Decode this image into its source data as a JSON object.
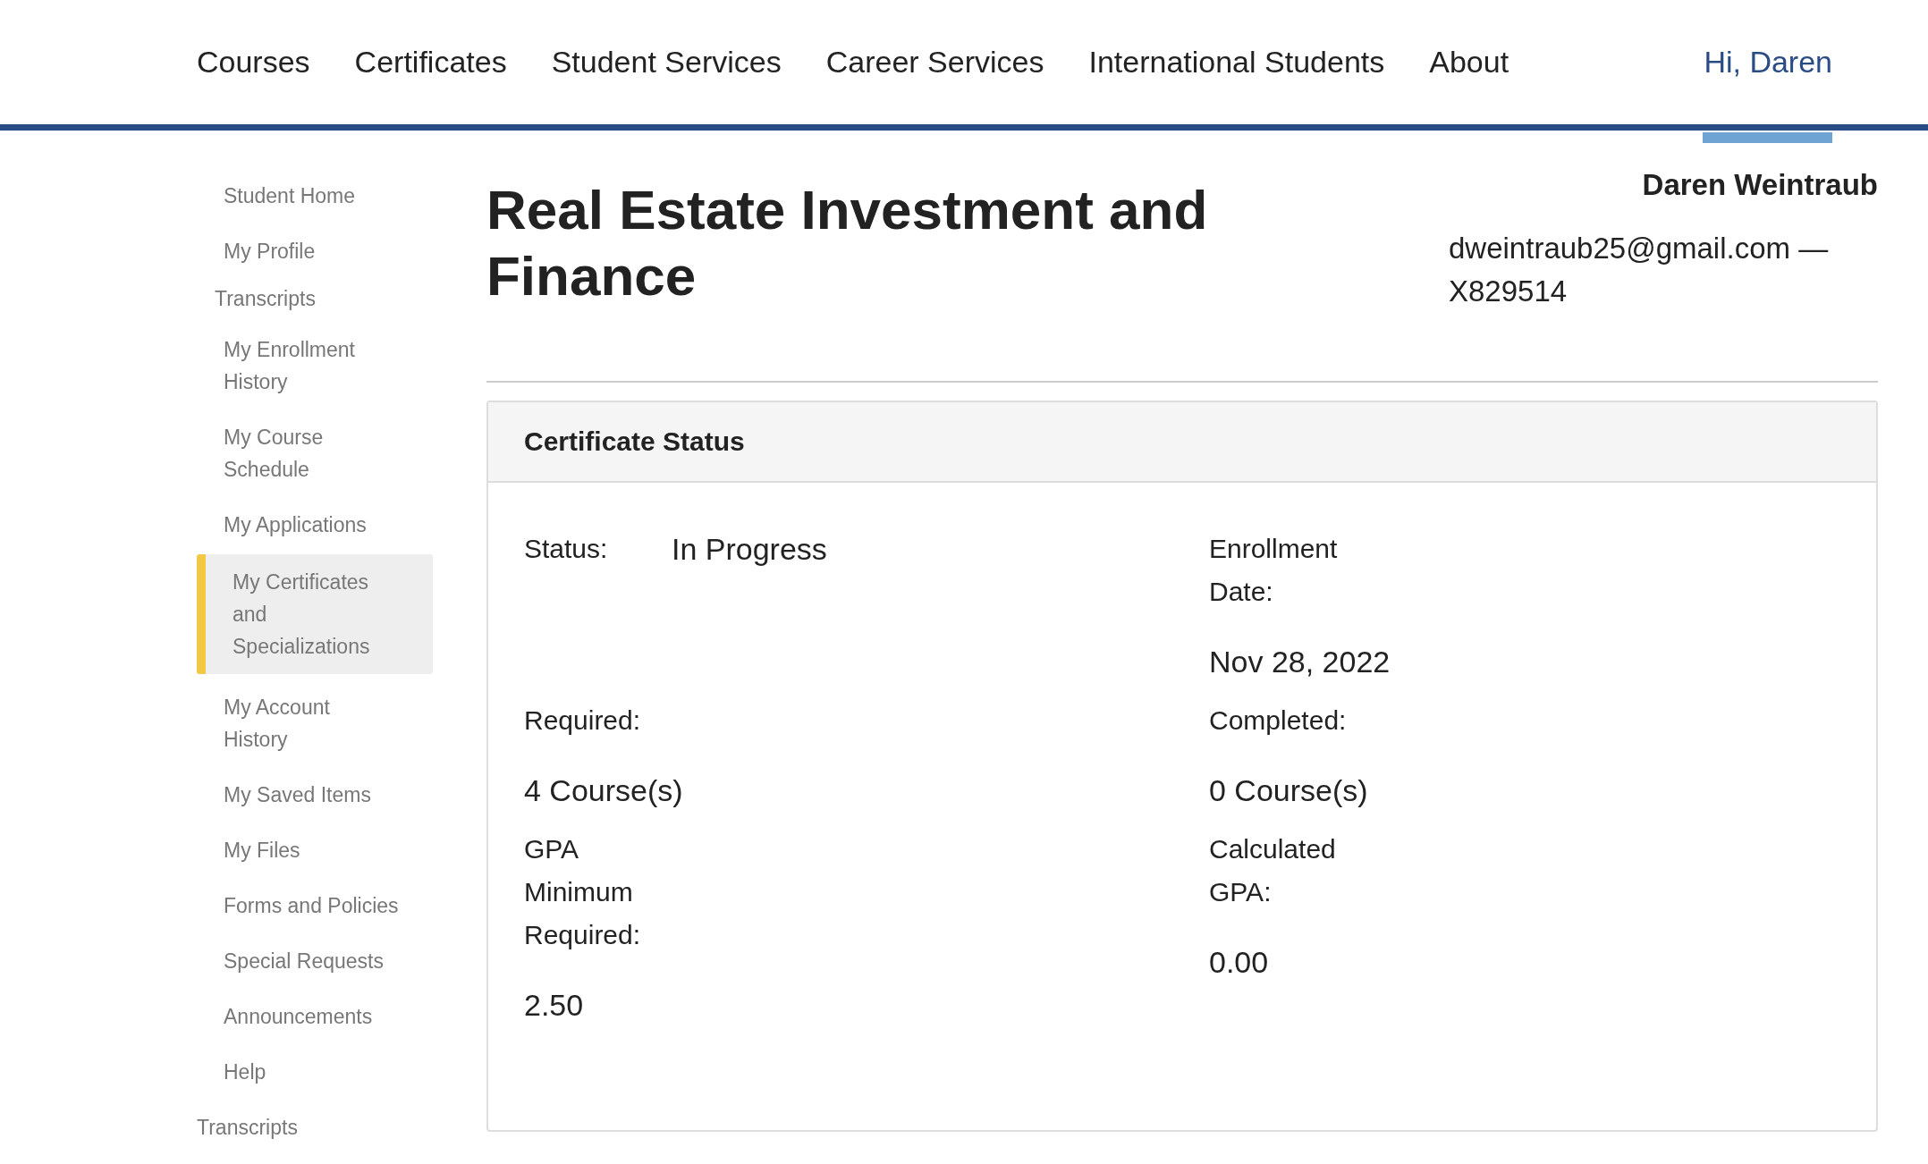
{
  "nav": {
    "items": [
      {
        "label": "Courses"
      },
      {
        "label": "Certificates"
      },
      {
        "label": "Student Services"
      },
      {
        "label": "Career Services"
      },
      {
        "label": "International Students"
      },
      {
        "label": "About"
      }
    ],
    "greeting": "Hi, Daren"
  },
  "sidebar": {
    "items": [
      {
        "label": "Student Home",
        "kind": "link",
        "selected": false
      },
      {
        "label": "My Profile",
        "kind": "link",
        "selected": false
      },
      {
        "label": "Transcripts",
        "kind": "heading",
        "selected": false
      },
      {
        "label": "My Enrollment History",
        "kind": "link",
        "selected": false
      },
      {
        "label": "My Course Schedule",
        "kind": "link",
        "selected": false
      },
      {
        "label": "My Applications",
        "kind": "link",
        "selected": false
      },
      {
        "label": "My Certificates and Specializations",
        "kind": "link",
        "selected": true
      },
      {
        "label": "My Account History",
        "kind": "link",
        "selected": false
      },
      {
        "label": "My Saved Items",
        "kind": "link",
        "selected": false
      },
      {
        "label": "My Files",
        "kind": "link",
        "selected": false
      },
      {
        "label": "Forms and Policies",
        "kind": "link",
        "selected": false
      },
      {
        "label": "Special Requests",
        "kind": "link",
        "selected": false
      },
      {
        "label": "Announcements",
        "kind": "link",
        "selected": false
      },
      {
        "label": "Help",
        "kind": "link",
        "selected": false
      },
      {
        "label": "Transcripts",
        "kind": "root",
        "selected": false
      }
    ]
  },
  "page": {
    "title": "Real Estate Investment and Finance",
    "user": {
      "name": "Daren Weintraub",
      "contact": "dweintraub25@gmail.com — X829514"
    }
  },
  "card": {
    "title": "Certificate Status",
    "fields": [
      {
        "label": "Status:",
        "value": "In Progress",
        "kind": "inline"
      },
      {
        "label": "Enrollment Date:",
        "value": "Nov 28, 2022",
        "kind": "stacked"
      },
      {
        "label": "Required:",
        "value": "4 Course(s)",
        "kind": "stacked"
      },
      {
        "label": "Completed:",
        "value": "0 Course(s)",
        "kind": "stacked"
      },
      {
        "label": "GPA Minimum Required:",
        "value": "2.50",
        "kind": "stacked"
      },
      {
        "label": "Calculated GPA:",
        "value": "0.00",
        "kind": "stacked"
      }
    ]
  }
}
